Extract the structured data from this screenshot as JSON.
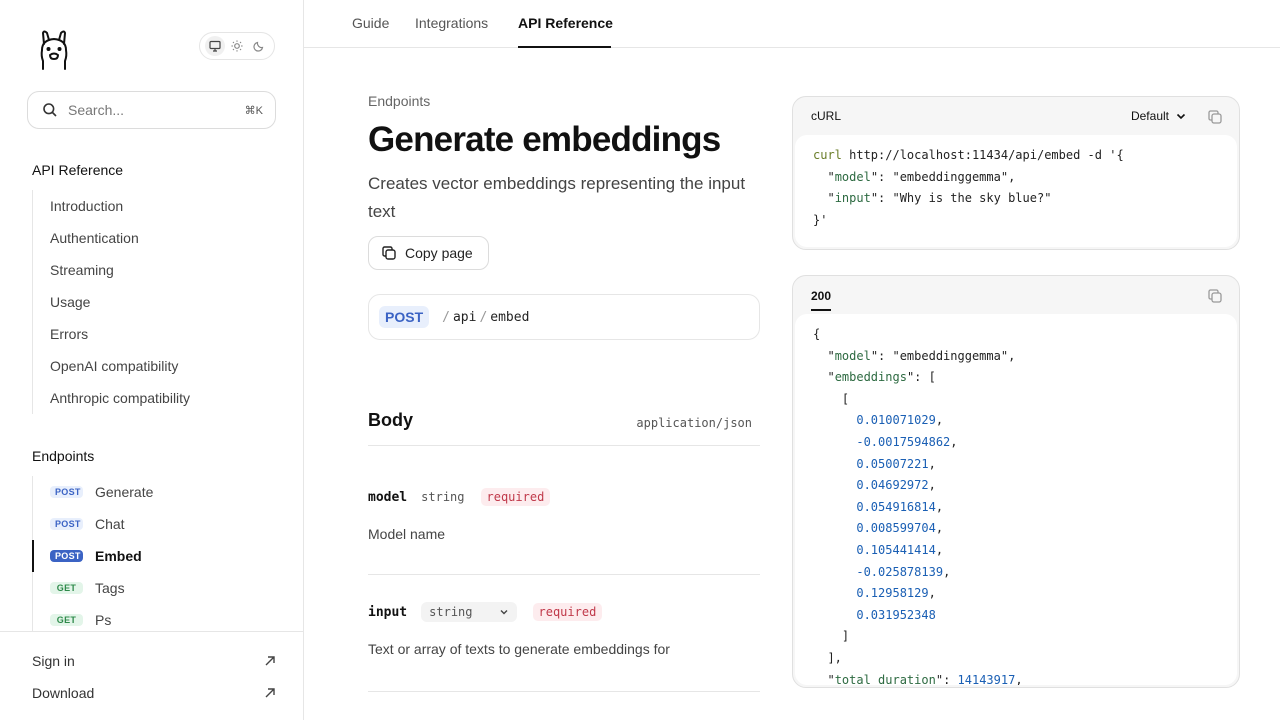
{
  "sidebar": {
    "search_placeholder": "Search...",
    "search_shortcut": "⌘K",
    "theme": [
      "monitor-icon",
      "sun-icon",
      "moon-icon"
    ],
    "api_reference": {
      "title": "API Reference",
      "items": [
        "Introduction",
        "Authentication",
        "Streaming",
        "Usage",
        "Errors",
        "OpenAI compatibility",
        "Anthropic compatibility"
      ]
    },
    "endpoints": {
      "title": "Endpoints",
      "items": [
        {
          "method": "POST",
          "label": "Generate"
        },
        {
          "method": "POST",
          "label": "Chat"
        },
        {
          "method": "POST",
          "label": "Embed"
        },
        {
          "method": "GET",
          "label": "Tags"
        },
        {
          "method": "GET",
          "label": "Ps"
        }
      ],
      "active": "Embed"
    },
    "footer": [
      {
        "label": "Sign in"
      },
      {
        "label": "Download"
      }
    ]
  },
  "topnav": {
    "tabs": [
      "Guide",
      "Integrations",
      "API Reference"
    ],
    "active": "API Reference"
  },
  "page": {
    "breadcrumb": "Endpoints",
    "title": "Generate embeddings",
    "subtitle": "Creates vector embeddings representing the input text",
    "copy_label": "Copy page",
    "endpoint": {
      "method": "POST",
      "path": [
        "api",
        "embed"
      ]
    }
  },
  "body": {
    "title": "Body",
    "content_type": "application/json",
    "params": [
      {
        "name": "model",
        "type": "string",
        "required": "required",
        "description": "Model name"
      },
      {
        "name": "input",
        "type": "string",
        "required": "required",
        "description": "Text or array of texts to generate embeddings for"
      }
    ]
  },
  "request_panel": {
    "title": "cURL",
    "variant": "Default",
    "lines": [
      [
        {
          "t": "kw",
          "v": "curl"
        },
        {
          "t": "plain",
          "v": " http://localhost:11434/api/embed -d '{"
        }
      ],
      [
        {
          "t": "plain",
          "v": "  \""
        },
        {
          "t": "key",
          "v": "model"
        },
        {
          "t": "plain",
          "v": "\": \"embeddinggemma\","
        }
      ],
      [
        {
          "t": "plain",
          "v": "  \""
        },
        {
          "t": "key",
          "v": "input"
        },
        {
          "t": "plain",
          "v": "\": \"Why is the sky blue?\""
        }
      ],
      [
        {
          "t": "plain",
          "v": "}'"
        }
      ]
    ]
  },
  "response_panel": {
    "status": "200",
    "lines": [
      [
        {
          "t": "plain",
          "v": "{"
        }
      ],
      [
        {
          "t": "plain",
          "v": "  \""
        },
        {
          "t": "key",
          "v": "model"
        },
        {
          "t": "plain",
          "v": "\": \"embeddinggemma\","
        }
      ],
      [
        {
          "t": "plain",
          "v": "  \""
        },
        {
          "t": "key",
          "v": "embeddings"
        },
        {
          "t": "plain",
          "v": "\": ["
        }
      ],
      [
        {
          "t": "plain",
          "v": "    ["
        }
      ],
      [
        {
          "t": "plain",
          "v": "      "
        },
        {
          "t": "num",
          "v": "0.010071029"
        },
        {
          "t": "plain",
          "v": ","
        }
      ],
      [
        {
          "t": "plain",
          "v": "      "
        },
        {
          "t": "num",
          "v": "-0.0017594862"
        },
        {
          "t": "plain",
          "v": ","
        }
      ],
      [
        {
          "t": "plain",
          "v": "      "
        },
        {
          "t": "num",
          "v": "0.05007221"
        },
        {
          "t": "plain",
          "v": ","
        }
      ],
      [
        {
          "t": "plain",
          "v": "      "
        },
        {
          "t": "num",
          "v": "0.04692972"
        },
        {
          "t": "plain",
          "v": ","
        }
      ],
      [
        {
          "t": "plain",
          "v": "      "
        },
        {
          "t": "num",
          "v": "0.054916814"
        },
        {
          "t": "plain",
          "v": ","
        }
      ],
      [
        {
          "t": "plain",
          "v": "      "
        },
        {
          "t": "num",
          "v": "0.008599704"
        },
        {
          "t": "plain",
          "v": ","
        }
      ],
      [
        {
          "t": "plain",
          "v": "      "
        },
        {
          "t": "num",
          "v": "0.105441414"
        },
        {
          "t": "plain",
          "v": ","
        }
      ],
      [
        {
          "t": "plain",
          "v": "      "
        },
        {
          "t": "num",
          "v": "-0.025878139"
        },
        {
          "t": "plain",
          "v": ","
        }
      ],
      [
        {
          "t": "plain",
          "v": "      "
        },
        {
          "t": "num",
          "v": "0.12958129"
        },
        {
          "t": "plain",
          "v": ","
        }
      ],
      [
        {
          "t": "plain",
          "v": "      "
        },
        {
          "t": "num",
          "v": "0.031952348"
        }
      ],
      [
        {
          "t": "plain",
          "v": "    ]"
        }
      ],
      [
        {
          "t": "plain",
          "v": "  ],"
        }
      ],
      [
        {
          "t": "plain",
          "v": "  \""
        },
        {
          "t": "key",
          "v": "total_duration"
        },
        {
          "t": "plain",
          "v": "\": "
        },
        {
          "t": "num",
          "v": "14143917"
        },
        {
          "t": "plain",
          "v": ","
        }
      ]
    ]
  }
}
